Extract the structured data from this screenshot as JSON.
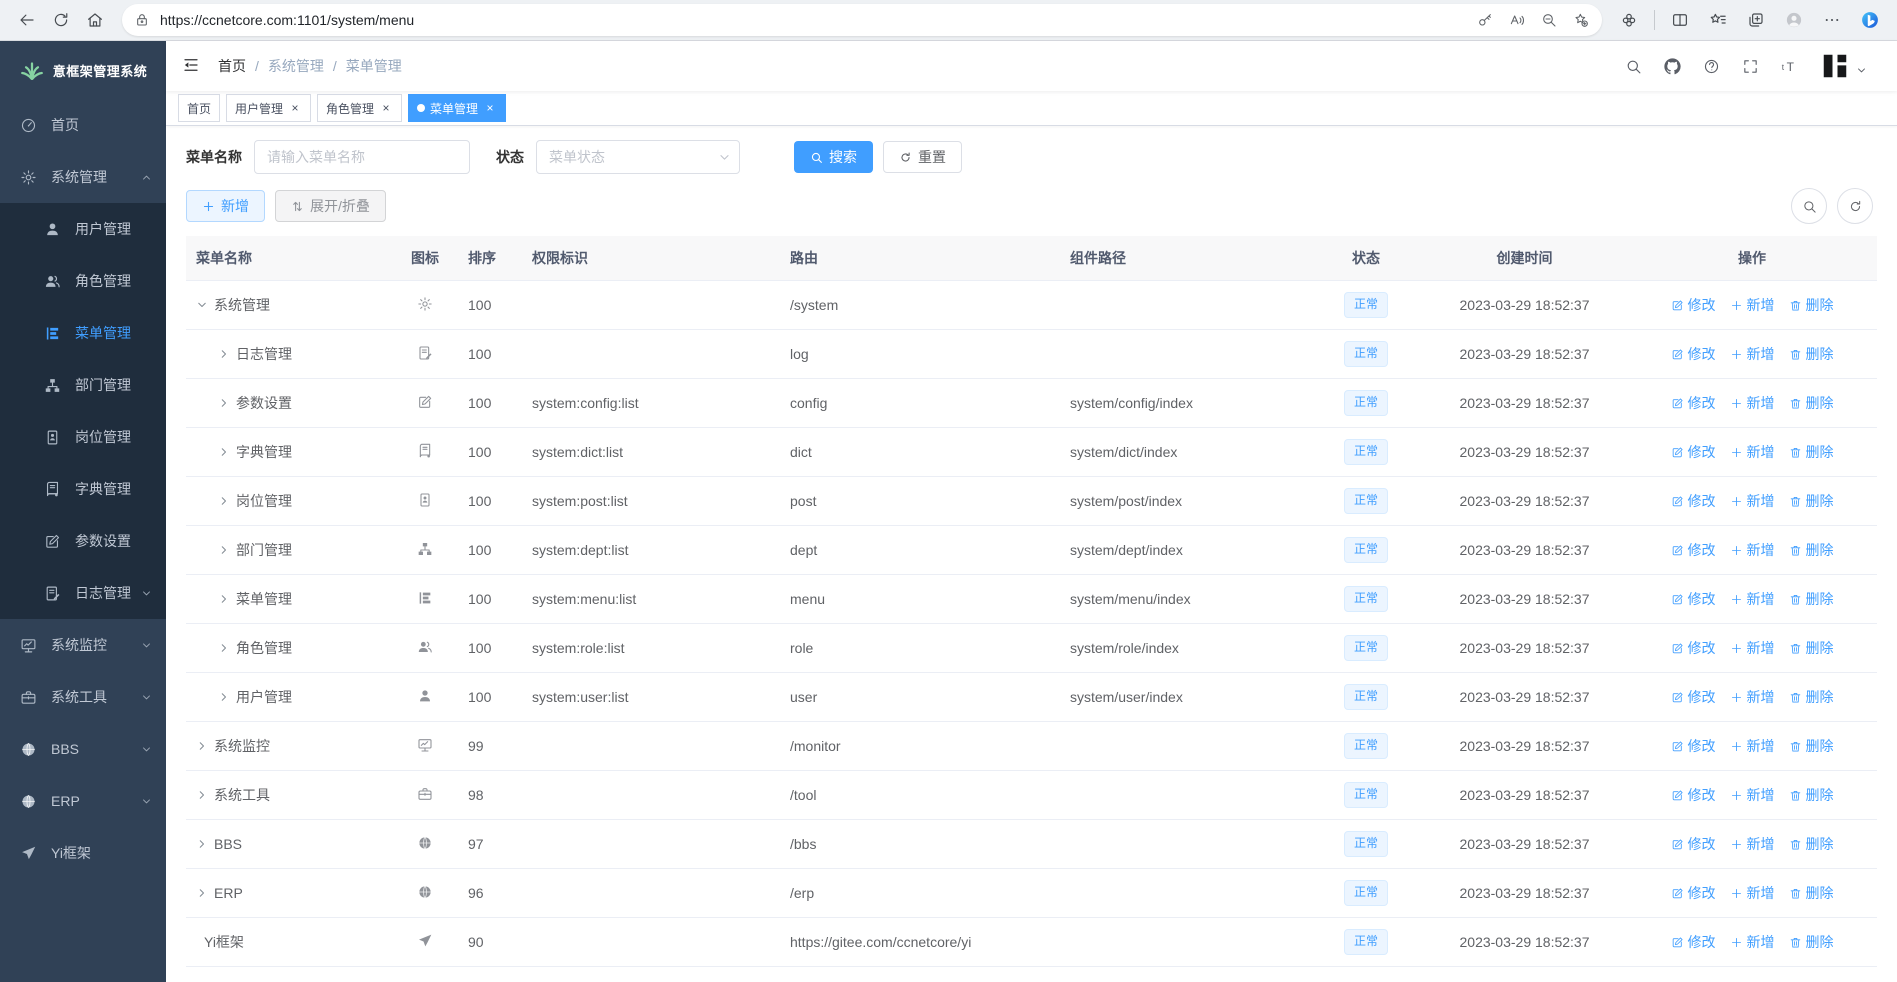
{
  "browser": {
    "url": "https://ccnetcore.com:1101/system/menu",
    "left_icons": [
      "back",
      "reload",
      "home"
    ],
    "url_lock_icon": "lock",
    "url_right_icons": [
      "key",
      "read-aloud",
      "zoom-out",
      "star-plus"
    ],
    "right_icons": [
      "extensions",
      "divider",
      "split-screen",
      "favorites",
      "collections",
      "profile",
      "more",
      "bing"
    ]
  },
  "sidebar": {
    "title": "意框架管理系统",
    "logo_icon": "plant",
    "items": [
      {
        "key": "home",
        "label": "首页",
        "icon": "dashboard",
        "level": "top"
      },
      {
        "key": "system",
        "label": "系统管理",
        "icon": "gear",
        "level": "top",
        "arrow": "up"
      },
      {
        "key": "user",
        "label": "用户管理",
        "icon": "user",
        "level": "sub"
      },
      {
        "key": "role",
        "label": "角色管理",
        "icon": "users",
        "level": "sub"
      },
      {
        "key": "menu",
        "label": "菜单管理",
        "icon": "menu-tree",
        "level": "sub",
        "active": true
      },
      {
        "key": "dept",
        "label": "部门管理",
        "icon": "sitemap",
        "level": "sub"
      },
      {
        "key": "post",
        "label": "岗位管理",
        "icon": "id-card",
        "level": "sub"
      },
      {
        "key": "dict",
        "label": "字典管理",
        "icon": "book",
        "level": "sub"
      },
      {
        "key": "config",
        "label": "参数设置",
        "icon": "edit-pen",
        "level": "sub"
      },
      {
        "key": "log",
        "label": "日志管理",
        "icon": "log",
        "level": "sub",
        "arrow": "down"
      },
      {
        "key": "monitor",
        "label": "系统监控",
        "icon": "monitor",
        "level": "top",
        "arrow": "down"
      },
      {
        "key": "tool",
        "label": "系统工具",
        "icon": "toolbox",
        "level": "top",
        "arrow": "down"
      },
      {
        "key": "bbs",
        "label": "BBS",
        "icon": "globe",
        "level": "top",
        "arrow": "down"
      },
      {
        "key": "erp",
        "label": "ERP",
        "icon": "globe",
        "level": "top",
        "arrow": "down"
      },
      {
        "key": "yi",
        "label": "Yi框架",
        "icon": "paper-plane",
        "level": "top"
      }
    ]
  },
  "navbar": {
    "breadcrumbs": [
      "首页",
      "系统管理",
      "菜单管理"
    ],
    "separator": "/",
    "icons": [
      "search",
      "github",
      "question",
      "fullscreen",
      "font-size"
    ],
    "avatar_icon": "yi-logo"
  },
  "tabsbar": {
    "close_glyph": "×",
    "tabs": [
      {
        "key": "home",
        "label": "首页",
        "closable": false,
        "active": false
      },
      {
        "key": "user",
        "label": "用户管理",
        "closable": true,
        "active": false
      },
      {
        "key": "role",
        "label": "角色管理",
        "closable": true,
        "active": false
      },
      {
        "key": "menu",
        "label": "菜单管理",
        "closable": true,
        "active": true
      }
    ]
  },
  "filter": {
    "name_label": "菜单名称",
    "name_placeholder": "请输入菜单名称",
    "status_label": "状态",
    "status_placeholder": "菜单状态",
    "search_label": "搜索",
    "reset_label": "重置"
  },
  "toolbar": {
    "add_label": "新增",
    "toggle_label": "展开/折叠",
    "right_icons": [
      "search",
      "refresh"
    ]
  },
  "table": {
    "columns": [
      "菜单名称",
      "图标",
      "排序",
      "权限标识",
      "路由",
      "组件路径",
      "状态",
      "创建时间",
      "操作"
    ],
    "op_edit": "修改",
    "op_add": "新增",
    "op_delete": "删除",
    "rows": [
      {
        "name": "系统管理",
        "level": 0,
        "caret": "expanded",
        "icon": "gear",
        "sort": "100",
        "perm": "",
        "route": "/system",
        "component": "",
        "status": "正常",
        "time": "2023-03-29 18:52:37"
      },
      {
        "name": "日志管理",
        "level": 1,
        "caret": "collapsed",
        "icon": "log",
        "sort": "100",
        "perm": "",
        "route": "log",
        "component": "",
        "status": "正常",
        "time": "2023-03-29 18:52:37"
      },
      {
        "name": "参数设置",
        "level": 1,
        "caret": "collapsed",
        "icon": "edit-pen",
        "sort": "100",
        "perm": "system:config:list",
        "route": "config",
        "component": "system/config/index",
        "status": "正常",
        "time": "2023-03-29 18:52:37"
      },
      {
        "name": "字典管理",
        "level": 1,
        "caret": "collapsed",
        "icon": "book",
        "sort": "100",
        "perm": "system:dict:list",
        "route": "dict",
        "component": "system/dict/index",
        "status": "正常",
        "time": "2023-03-29 18:52:37"
      },
      {
        "name": "岗位管理",
        "level": 1,
        "caret": "collapsed",
        "icon": "id-card",
        "sort": "100",
        "perm": "system:post:list",
        "route": "post",
        "component": "system/post/index",
        "status": "正常",
        "time": "2023-03-29 18:52:37"
      },
      {
        "name": "部门管理",
        "level": 1,
        "caret": "collapsed",
        "icon": "sitemap",
        "sort": "100",
        "perm": "system:dept:list",
        "route": "dept",
        "component": "system/dept/index",
        "status": "正常",
        "time": "2023-03-29 18:52:37"
      },
      {
        "name": "菜单管理",
        "level": 1,
        "caret": "collapsed",
        "icon": "menu-tree",
        "sort": "100",
        "perm": "system:menu:list",
        "route": "menu",
        "component": "system/menu/index",
        "status": "正常",
        "time": "2023-03-29 18:52:37"
      },
      {
        "name": "角色管理",
        "level": 1,
        "caret": "collapsed",
        "icon": "users",
        "sort": "100",
        "perm": "system:role:list",
        "route": "role",
        "component": "system/role/index",
        "status": "正常",
        "time": "2023-03-29 18:52:37"
      },
      {
        "name": "用户管理",
        "level": 1,
        "caret": "collapsed",
        "icon": "user",
        "sort": "100",
        "perm": "system:user:list",
        "route": "user",
        "component": "system/user/index",
        "status": "正常",
        "time": "2023-03-29 18:52:37"
      },
      {
        "name": "系统监控",
        "level": 0,
        "caret": "collapsed",
        "icon": "monitor",
        "sort": "99",
        "perm": "",
        "route": "/monitor",
        "component": "",
        "status": "正常",
        "time": "2023-03-29 18:52:37"
      },
      {
        "name": "系统工具",
        "level": 0,
        "caret": "collapsed",
        "icon": "toolbox",
        "sort": "98",
        "perm": "",
        "route": "/tool",
        "component": "",
        "status": "正常",
        "time": "2023-03-29 18:52:37"
      },
      {
        "name": "BBS",
        "level": 0,
        "caret": "collapsed",
        "icon": "globe",
        "sort": "97",
        "perm": "",
        "route": "/bbs",
        "component": "",
        "status": "正常",
        "time": "2023-03-29 18:52:37"
      },
      {
        "name": "ERP",
        "level": 0,
        "caret": "collapsed",
        "icon": "globe",
        "sort": "96",
        "perm": "",
        "route": "/erp",
        "component": "",
        "status": "正常",
        "time": "2023-03-29 18:52:37"
      },
      {
        "name": "Yi框架",
        "level": 0,
        "caret": "none",
        "icon": "paper-plane",
        "sort": "90",
        "perm": "",
        "route": "https://gitee.com/ccnetcore/yi",
        "component": "",
        "status": "正常",
        "time": "2023-03-29 18:52:37"
      }
    ]
  }
}
